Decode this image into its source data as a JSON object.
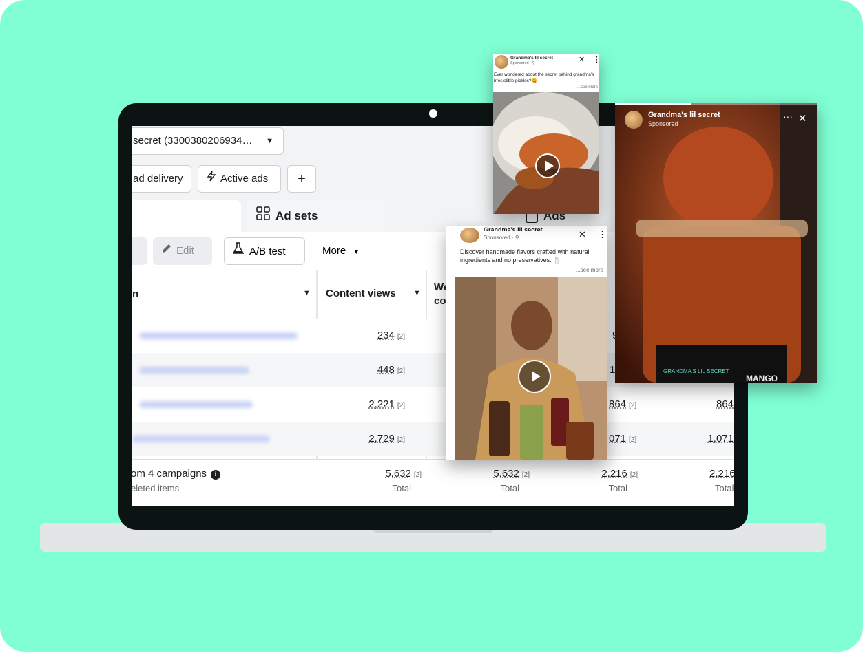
{
  "account": {
    "name": "secret (3300380206934…"
  },
  "filters": {
    "ad_delivery": "ad delivery",
    "active_ads": "Active ads",
    "add": "+"
  },
  "tabs": {
    "ad_sets": "Ad sets",
    "ads": "Ads"
  },
  "toolbar": {
    "edit": "Edit",
    "ab_test": "A/B test",
    "more": "More"
  },
  "table": {
    "headers": {
      "content_views": "Content views",
      "next_col_line1": "We",
      "next_col_line2": "co"
    },
    "rows": [
      {
        "content_views": "234",
        "note": "[2]",
        "col3": "9"
      },
      {
        "content_views": "448",
        "note": "[2]",
        "col3": "1"
      },
      {
        "content_views": "2,221",
        "note": "[2]",
        "col4": "864",
        "col5": "864"
      },
      {
        "content_views": "2,729",
        "note": "[2]",
        "col4": "071",
        "col5": "1,071"
      }
    ],
    "summary": {
      "title": "om 4 campaigns",
      "subtitle": "eleted items",
      "total_label": "Total",
      "col1": "5,632",
      "col2": "5,632",
      "col3": "2,216",
      "col4": "2,216",
      "note": "[2]"
    }
  },
  "ad_card_1": {
    "page_name": "Grandma's lil secret",
    "sponsored": "Sponsored · ⚲",
    "text": "Ever wondered about the secret behind grandma's irresistible pickles?😋",
    "see_more": "...see more",
    "close": "✕",
    "menu": "⋮"
  },
  "ad_card_2": {
    "page_name": "Grandma's lil secret",
    "sponsored": "Sponsored · ⚲",
    "text": "Discover handmade flavors crafted with natural ingredients and no preservatives. 🍴",
    "see_more": "...see more",
    "close": "✕",
    "menu": "⋮"
  },
  "story_card": {
    "page_name": "Grandma's lil secret",
    "sponsored": "Sponsored",
    "menu": "···",
    "close": "✕",
    "jar_label": "GRANDMA'S LIL SECRET",
    "jar_text": "MANGO"
  },
  "colors": {
    "background": "#80ffd4",
    "laptop": "#0c1413",
    "link": "#1c1e21"
  }
}
